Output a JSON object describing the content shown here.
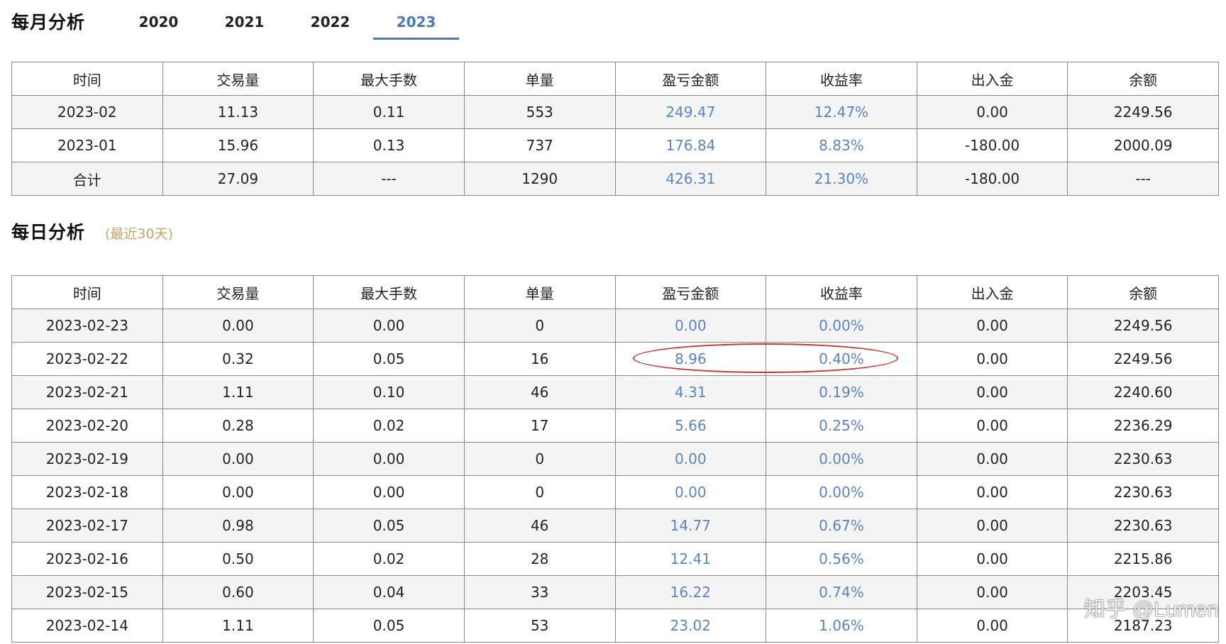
{
  "monthly": {
    "title": "每月分析",
    "year_tabs": [
      {
        "label": "2020",
        "active": false
      },
      {
        "label": "2021",
        "active": false
      },
      {
        "label": "2022",
        "active": false
      },
      {
        "label": "2023",
        "active": true
      }
    ],
    "columns": [
      "时间",
      "交易量",
      "最大手数",
      "单量",
      "盈亏金额",
      "收益率",
      "出入金",
      "余额"
    ],
    "rows": [
      [
        "2023-02",
        "11.13",
        "0.11",
        "553",
        "249.47",
        "12.47%",
        "0.00",
        "2249.56"
      ],
      [
        "2023-01",
        "15.96",
        "0.13",
        "737",
        "176.84",
        "8.83%",
        "-180.00",
        "2000.09"
      ],
      [
        "合计",
        "27.09",
        "---",
        "1290",
        "426.31",
        "21.30%",
        "-180.00",
        "---"
      ]
    ]
  },
  "daily": {
    "title": "每日分析",
    "subtitle": "(最近30天)",
    "columns": [
      "时间",
      "交易量",
      "最大手数",
      "单量",
      "盈亏金额",
      "收益率",
      "出入金",
      "余额"
    ],
    "rows": [
      [
        "2023-02-23",
        "0.00",
        "0.00",
        "0",
        "0.00",
        "0.00%",
        "0.00",
        "2249.56"
      ],
      [
        "2023-02-22",
        "0.32",
        "0.05",
        "16",
        "8.96",
        "0.40%",
        "0.00",
        "2249.56"
      ],
      [
        "2023-02-21",
        "1.11",
        "0.10",
        "46",
        "4.31",
        "0.19%",
        "0.00",
        "2240.60"
      ],
      [
        "2023-02-20",
        "0.28",
        "0.02",
        "17",
        "5.66",
        "0.25%",
        "0.00",
        "2236.29"
      ],
      [
        "2023-02-19",
        "0.00",
        "0.00",
        "0",
        "0.00",
        "0.00%",
        "0.00",
        "2230.63"
      ],
      [
        "2023-02-18",
        "0.00",
        "0.00",
        "0",
        "0.00",
        "0.00%",
        "0.00",
        "2230.63"
      ],
      [
        "2023-02-17",
        "0.98",
        "0.05",
        "46",
        "14.77",
        "0.67%",
        "0.00",
        "2230.63"
      ],
      [
        "2023-02-16",
        "0.50",
        "0.02",
        "28",
        "12.41",
        "0.56%",
        "0.00",
        "2215.86"
      ],
      [
        "2023-02-15",
        "0.60",
        "0.04",
        "33",
        "16.22",
        "0.74%",
        "0.00",
        "2203.45"
      ],
      [
        "2023-02-14",
        "1.11",
        "0.05",
        "53",
        "23.02",
        "1.06%",
        "0.00",
        "2187.23"
      ]
    ]
  },
  "colors": {
    "accent": "#4a7ab5",
    "profit_text": "#5a84c4",
    "subtitle": "#c8a46a",
    "annotation": "#cc3333"
  },
  "watermark": "知乎 @Lumen"
}
